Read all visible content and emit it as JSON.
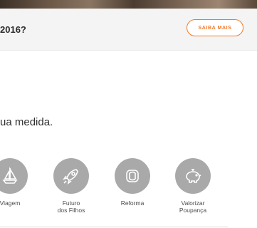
{
  "banner": {
    "title": "2016?",
    "cta_label": "SAIBA MAIS"
  },
  "headline": "ua medida.",
  "goals": [
    {
      "label_line1": "Viagem",
      "label_line2": "",
      "icon": "sailboat-icon"
    },
    {
      "label_line1": "Futuro",
      "label_line2": "dos Filhos",
      "icon": "rocket-icon"
    },
    {
      "label_line1": "Reforma",
      "label_line2": "",
      "icon": "sofa-icon"
    },
    {
      "label_line1": "Valorizar",
      "label_line2": "Poupança",
      "icon": "piggy-bank-icon"
    }
  ],
  "colors": {
    "accent": "#f07a2a",
    "icon_circle": "#a9a9a9",
    "banner_bg": "#f4f4f4"
  }
}
